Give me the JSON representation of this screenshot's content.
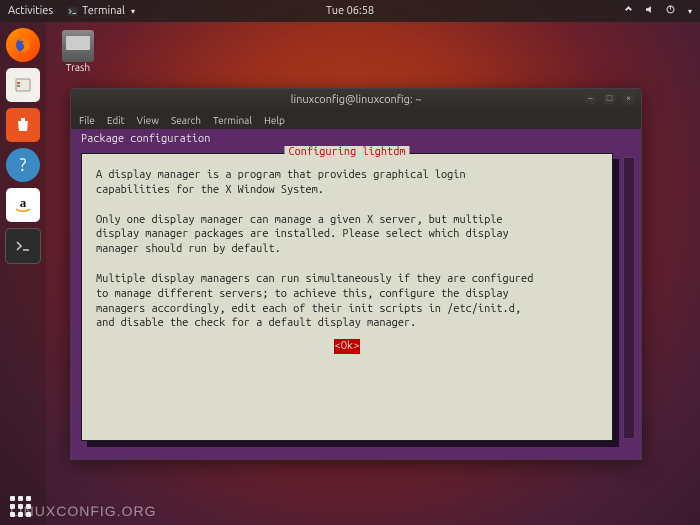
{
  "topbar": {
    "activities": "Activities",
    "app": "Terminal",
    "clock": "Tue 06:58"
  },
  "desktop": {
    "trash_label": "Trash"
  },
  "window": {
    "title": "linuxconfig@linuxconfig: ~",
    "menu": [
      "File",
      "Edit",
      "View",
      "Search",
      "Terminal",
      "Help"
    ]
  },
  "debconf": {
    "header": "Package configuration",
    "box_title": "Configuring lightdm",
    "para1": "A display manager is a program that provides graphical login\ncapabilities for the X Window System.",
    "para2": "Only one display manager can manage a given X server, but multiple\ndisplay manager packages are installed. Please select which display\nmanager should run by default.",
    "para3": "Multiple display managers can run simultaneously if they are configured\nto manage different servers; to achieve this, configure the display\nmanagers accordingly, edit each of their init scripts in /etc/init.d,\nand disable the check for a default display manager.",
    "ok": "<Ok>"
  },
  "watermark": "LINUXCONFIG.ORG"
}
